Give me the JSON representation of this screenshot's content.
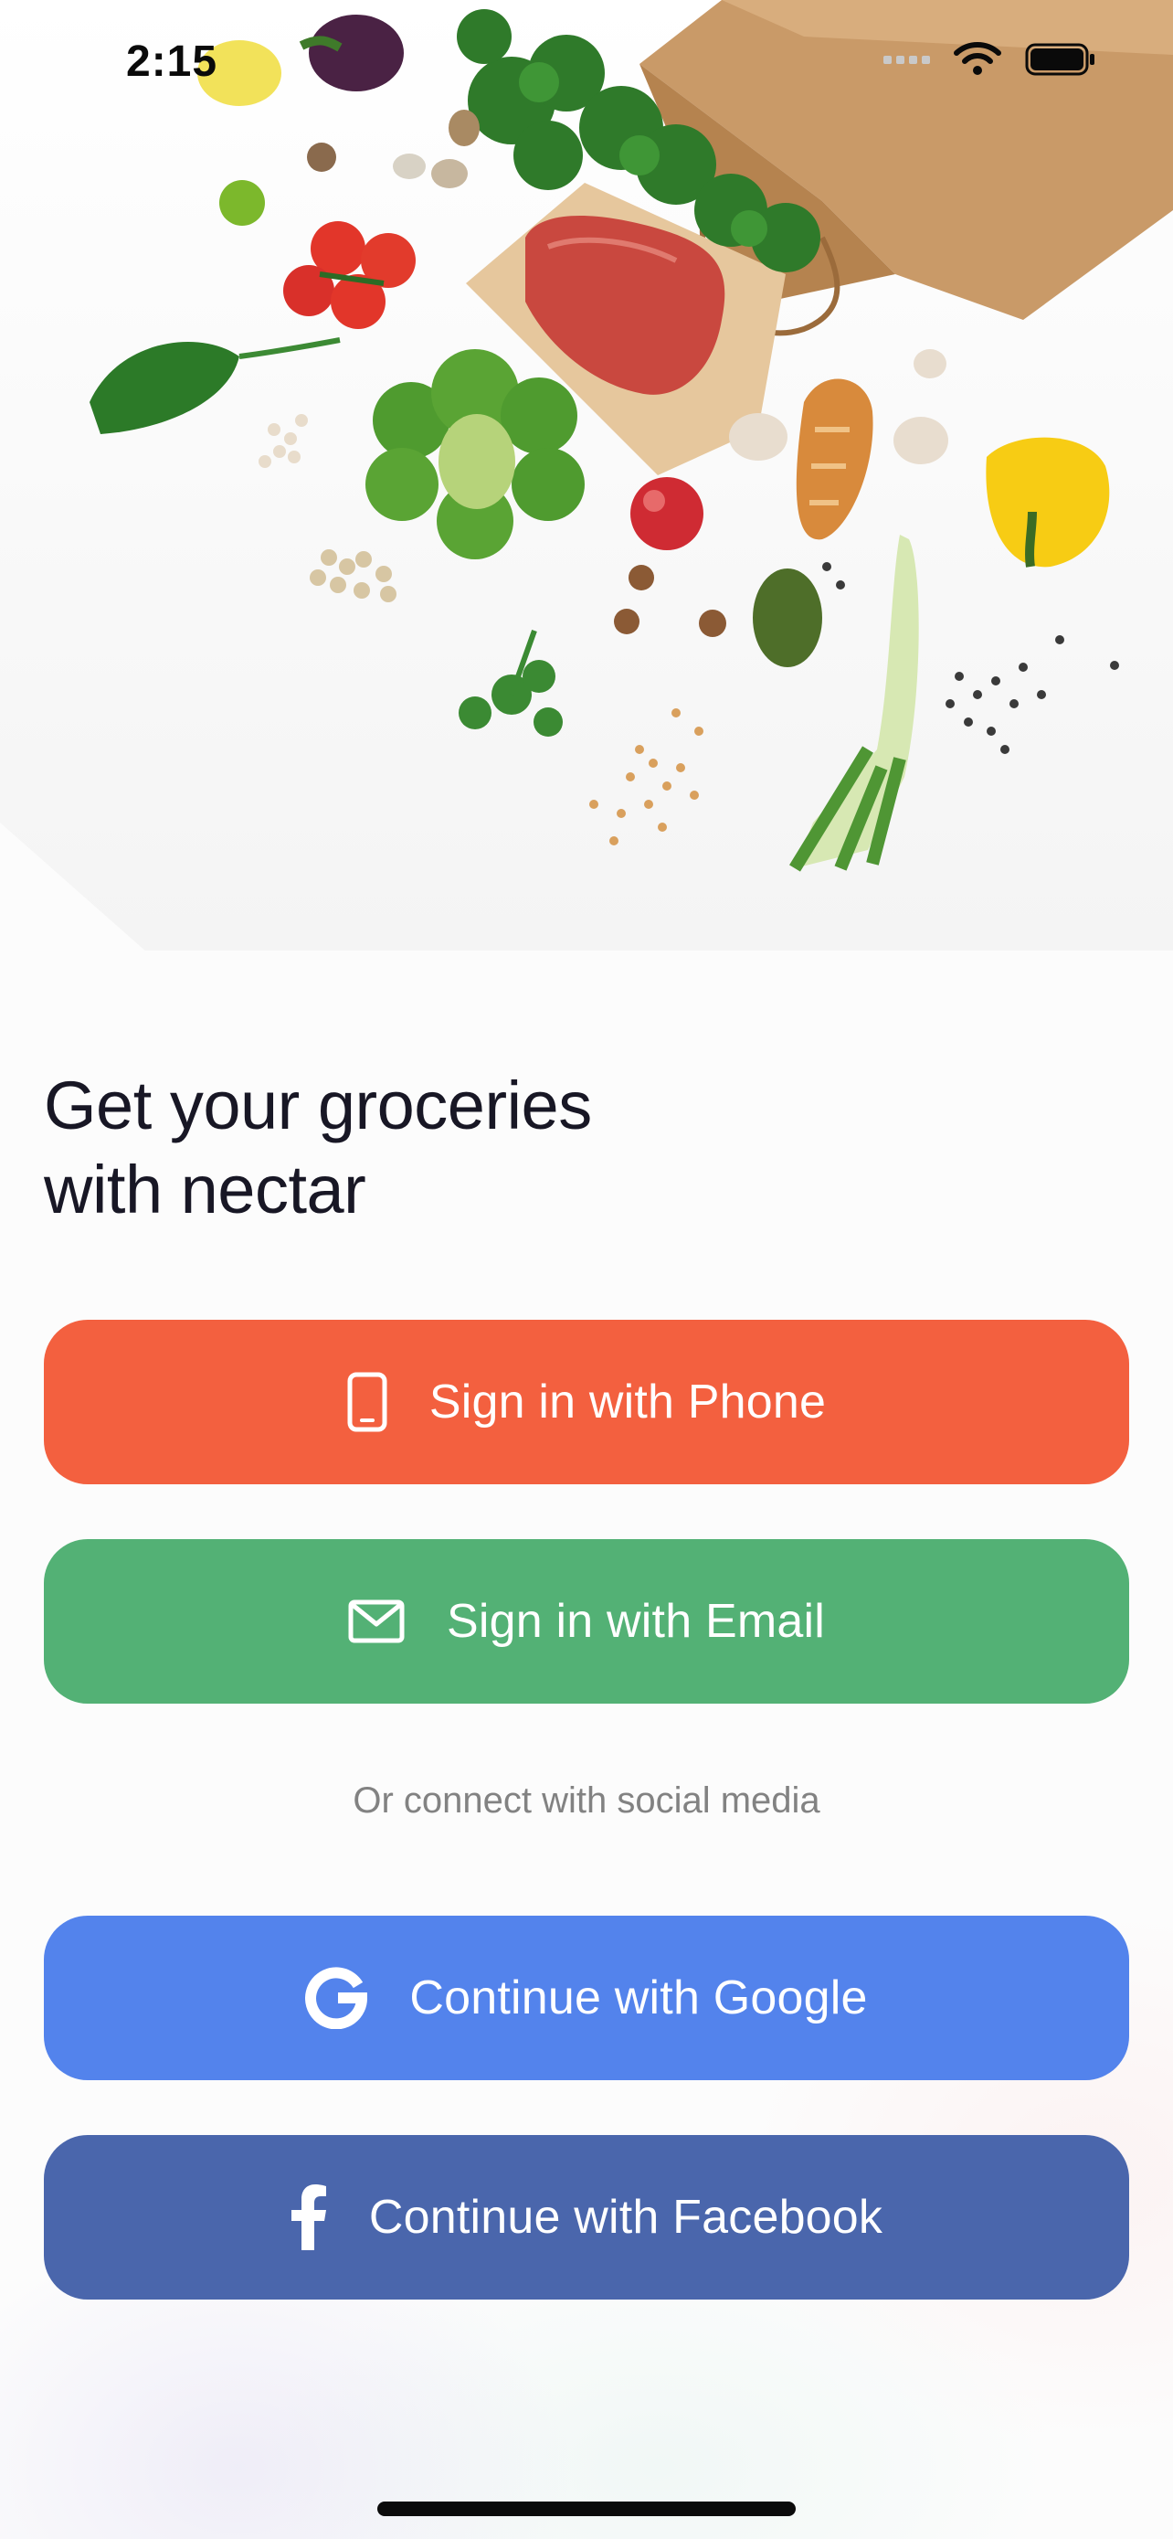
{
  "status_bar": {
    "time": "2:15"
  },
  "headline": {
    "line1": "Get your groceries",
    "line2": "with nectar"
  },
  "buttons": {
    "phone": {
      "label": "Sign in with Phone",
      "icon": "phone-icon",
      "color": "#F3603F"
    },
    "email": {
      "label": "Sign in with Email",
      "icon": "mail-icon",
      "color": "#53B175"
    },
    "google": {
      "label": "Continue with Google",
      "icon": "google-icon",
      "color": "#5383EC"
    },
    "facebook": {
      "label": "Continue with Facebook",
      "icon": "facebook-icon",
      "color": "#4A66AC"
    }
  },
  "divider_text": "Or connect with social media"
}
